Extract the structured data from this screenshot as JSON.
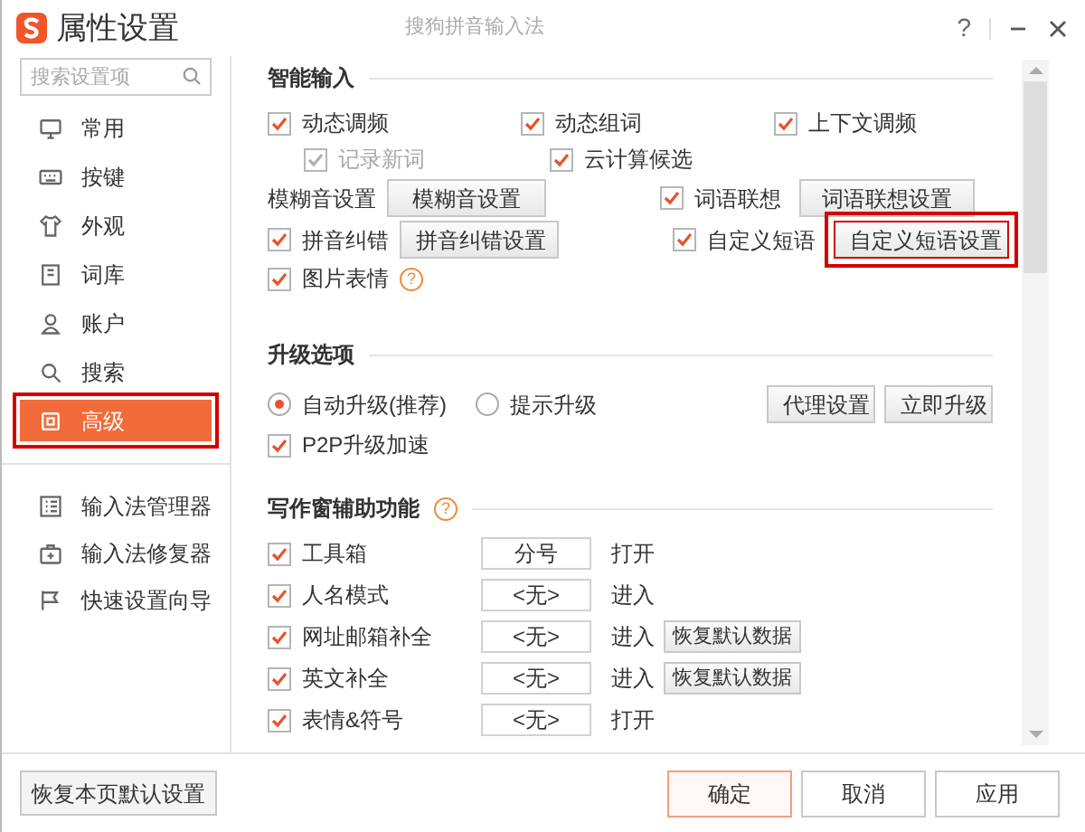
{
  "window": {
    "title": "属性设置",
    "subtitle": "搜狗拼音输入法",
    "help": "?"
  },
  "search": {
    "placeholder": "搜索设置项"
  },
  "nav": [
    {
      "label": "常用",
      "selected": false,
      "highlighted": false
    },
    {
      "label": "按键",
      "selected": false,
      "highlighted": false
    },
    {
      "label": "外观",
      "selected": false,
      "highlighted": false
    },
    {
      "label": "词库",
      "selected": false,
      "highlighted": false
    },
    {
      "label": "账户",
      "selected": false,
      "highlighted": false
    },
    {
      "label": "搜索",
      "selected": false,
      "highlighted": false
    },
    {
      "label": "高级",
      "selected": true,
      "highlighted": true
    }
  ],
  "tools": [
    {
      "label": "输入法管理器"
    },
    {
      "label": "输入法修复器"
    },
    {
      "label": "快速设置向导"
    }
  ],
  "restore_button": "恢复本页默认设置",
  "smart_input": {
    "title": "智能输入",
    "rows": [
      {
        "kind": "triple",
        "items": [
          {
            "kind": "checkbox",
            "label": "动态调频",
            "checked": true,
            "disabled": false
          },
          {
            "kind": "checkbox",
            "label": "动态组词",
            "checked": true,
            "disabled": false
          },
          {
            "kind": "checkbox",
            "label": "上下文调频",
            "checked": true,
            "disabled": false
          }
        ]
      },
      {
        "kind": "indented",
        "items": [
          {
            "kind": "checkbox",
            "label": "记录新词",
            "checked": true,
            "disabled": true
          },
          {
            "kind": "checkbox",
            "label": "云计算候选",
            "checked": true,
            "disabled": false
          }
        ]
      },
      {
        "kind": "pair",
        "items": [
          {
            "kind": "label",
            "label": "模糊音设置"
          },
          {
            "kind": "button",
            "label": "模糊音设置",
            "highlighted": false
          },
          {
            "kind": "checkbox",
            "label": "词语联想",
            "checked": true,
            "disabled": false
          },
          {
            "kind": "button",
            "label": "词语联想设置",
            "highlighted": false
          }
        ]
      },
      {
        "kind": "pair",
        "items": [
          {
            "kind": "checkbox",
            "label": "拼音纠错",
            "checked": true,
            "disabled": false
          },
          {
            "kind": "button",
            "label": "拼音纠错设置",
            "highlighted": false
          },
          {
            "kind": "checkbox",
            "label": "自定义短语",
            "checked": true,
            "disabled": false
          },
          {
            "kind": "button",
            "label": "自定义短语设置",
            "highlighted": true
          }
        ]
      },
      {
        "kind": "single",
        "items": [
          {
            "kind": "checkbox",
            "label": "图片表情",
            "checked": true,
            "disabled": false
          },
          {
            "kind": "help",
            "label": "?"
          }
        ]
      }
    ]
  },
  "upgrade": {
    "title": "升级选项",
    "options": [
      {
        "label": "自动升级(推荐)",
        "selected": true
      },
      {
        "label": "提示升级",
        "selected": false
      }
    ],
    "buttons": [
      "代理设置",
      "立即升级"
    ],
    "p2p": {
      "label": "P2P升级加速",
      "checked": true
    }
  },
  "writing": {
    "title": "写作窗辅助功能",
    "help": "?",
    "rows": [
      {
        "label": "工具箱",
        "checked": true,
        "key": "分号",
        "action": "打开"
      },
      {
        "label": "人名模式",
        "checked": true,
        "key": "<无>",
        "action": "进入"
      },
      {
        "label": "网址邮箱补全",
        "checked": true,
        "key": "<无>",
        "action": "进入",
        "button": "恢复默认数据"
      },
      {
        "label": "英文补全",
        "checked": true,
        "key": "<无>",
        "action": "进入",
        "button": "恢复默认数据"
      },
      {
        "label": "表情&符号",
        "checked": true,
        "key": "<无>",
        "action": "打开"
      }
    ]
  },
  "footer": [
    {
      "label": "确定",
      "primary": true
    },
    {
      "label": "取消",
      "primary": false
    },
    {
      "label": "应用",
      "primary": false
    }
  ]
}
